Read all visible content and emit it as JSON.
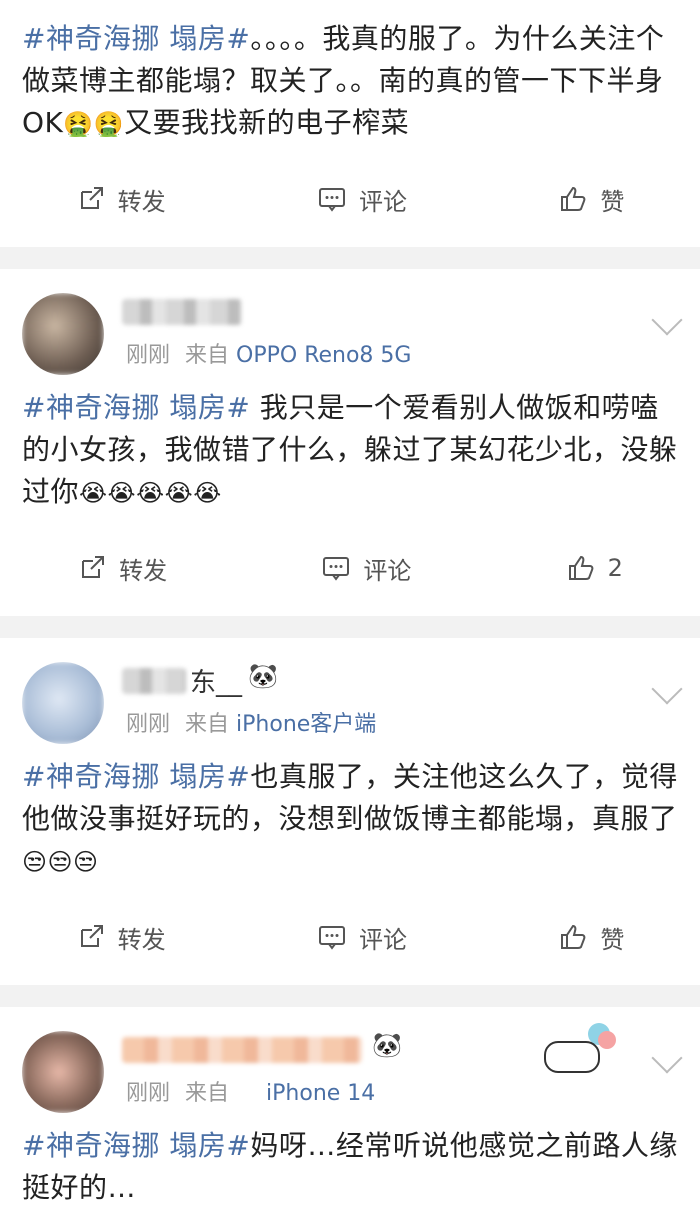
{
  "posts": [
    {
      "text_hashtag": "#神奇海挪 塌房#",
      "text_body": "。。。。我真的服了。为什么关注个做菜博主都能塌？取关了。。南的真的管一下下半身OK",
      "text_tail": "又要我找新的电子榨菜",
      "emojis": "🤮🤮",
      "actions": {
        "repost": "转发",
        "comment": "评论",
        "like": "赞"
      }
    },
    {
      "meta_time": "刚刚",
      "meta_from": "来自",
      "meta_source": "OPPO Reno8 5G",
      "text_hashtag": "#神奇海挪 塌房#",
      "text_body": " 我只是一个爱看别人做饭和唠嗑的小女孩，我做错了什么，躲过了某幻花少北，没躲过你",
      "emojis": "😭😭😭😭😭",
      "actions": {
        "repost": "转发",
        "comment": "评论",
        "like": "2"
      }
    },
    {
      "meta_time": "刚刚",
      "meta_from": "来自",
      "meta_source": "iPhone客户端",
      "name_suffix": "东__",
      "text_hashtag": "#神奇海挪 塌房#",
      "text_body": "也真服了，关注他这么久了，觉得他做没事挺好玩的，没想到做饭博主都能塌，真服了",
      "emojis": "😒😒😒",
      "actions": {
        "repost": "转发",
        "comment": "评论",
        "like": "赞"
      }
    },
    {
      "meta_time": "刚刚",
      "meta_from": "来自",
      "meta_source": "iPhone 14",
      "text_hashtag": "#神奇海挪 塌房#",
      "text_body": "妈呀…经常听说他感觉之前路人缘挺好的…"
    }
  ],
  "icons": {
    "panda": "panda-icon",
    "repost": "repost-icon",
    "comment": "comment-icon",
    "like": "like-icon",
    "chevron": "chevron-down-icon"
  },
  "colors": {
    "link": "#4a6fa5",
    "meta": "#999999",
    "background": "#f2f2f2"
  }
}
